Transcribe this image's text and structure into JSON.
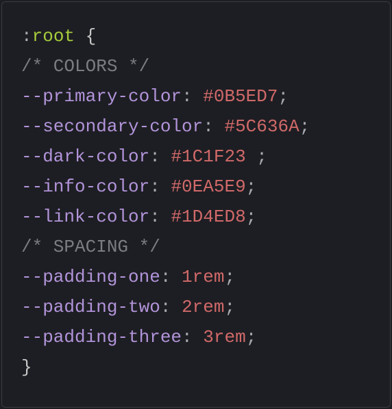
{
  "code": {
    "selector_colon": ":",
    "selector_name": "root",
    "open_brace": " {",
    "comment_colors": "/* COLORS */",
    "var_primary": "--primary-color",
    "val_primary": "#0B5ED7",
    "var_secondary": "--secondary-color",
    "val_secondary": "#5C636A",
    "var_dark": "--dark-color",
    "val_dark": "#1C1F23",
    "var_info": "--info-color",
    "val_info": "#0EA5E9",
    "var_link": "--link-color",
    "val_link": "#1D4ED8",
    "comment_spacing": "/* SPACING */",
    "var_pad1": "--padding-one",
    "num_pad1": "1",
    "unit_pad1": "rem",
    "var_pad2": "--padding-two",
    "num_pad2": "2",
    "unit_pad2": "rem",
    "var_pad3": "--padding-three",
    "num_pad3": "3",
    "unit_pad3": "rem",
    "close_brace": "}",
    "colon_sep": ":",
    "space": " ",
    "semi": ";"
  }
}
